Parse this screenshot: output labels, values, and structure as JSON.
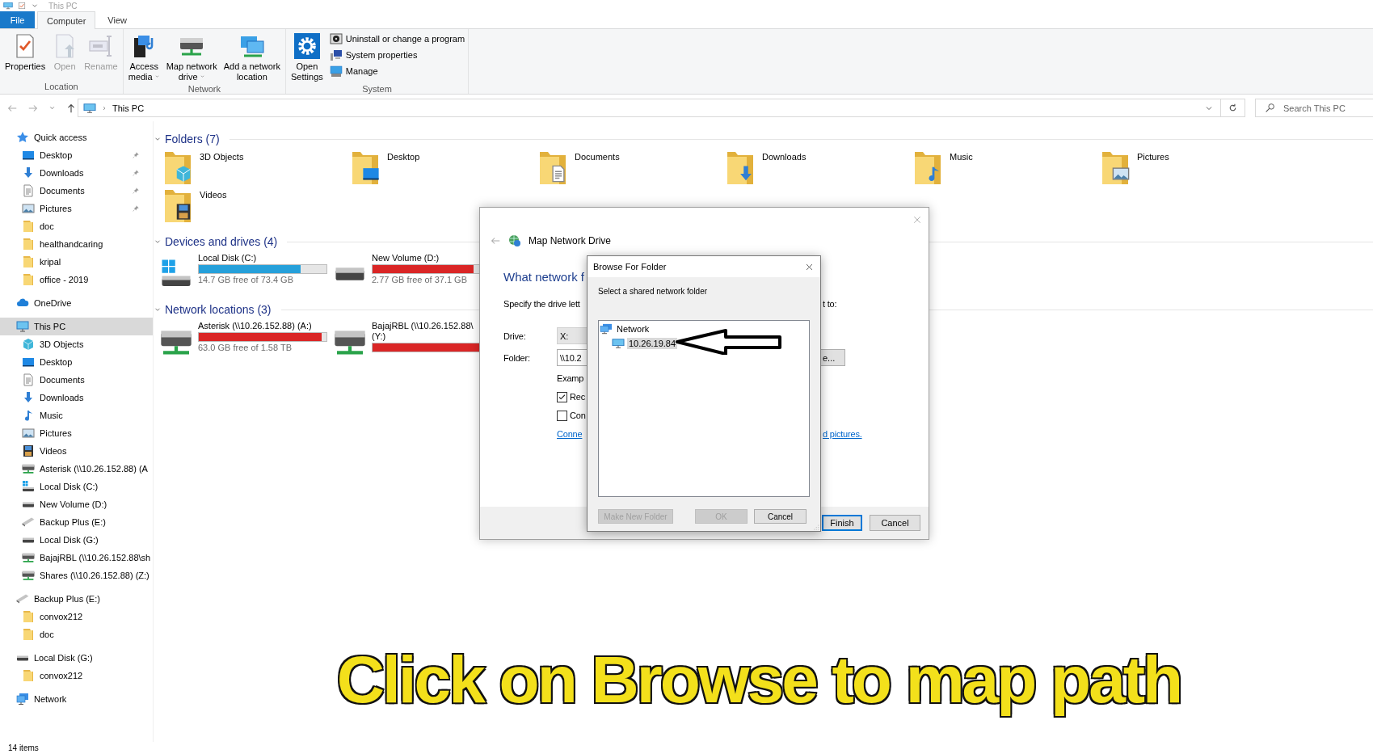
{
  "window": {
    "title": "This PC"
  },
  "ribbon": {
    "tabs": [
      {
        "label": "File",
        "kind": "file",
        "selected": false
      },
      {
        "label": "Computer",
        "kind": "tab",
        "selected": true
      },
      {
        "label": "View",
        "kind": "tab",
        "selected": false
      }
    ],
    "groups": [
      {
        "label": "Location",
        "buttons": [
          {
            "label": "Properties",
            "disabled": false,
            "dropdown": false
          },
          {
            "label": "Open",
            "disabled": true,
            "dropdown": false
          },
          {
            "label": "Rename",
            "disabled": true,
            "dropdown": false
          }
        ]
      },
      {
        "label": "Network",
        "buttons": [
          {
            "label": "Access\nmedia",
            "disabled": false,
            "dropdown": true
          },
          {
            "label": "Map network\ndrive",
            "disabled": false,
            "dropdown": true
          },
          {
            "label": "Add a network\nlocation",
            "disabled": false,
            "dropdown": false
          }
        ]
      },
      {
        "label": "System",
        "buttons": [
          {
            "label": "Open\nSettings",
            "disabled": false,
            "dropdown": false
          }
        ],
        "small_buttons": [
          {
            "label": "Uninstall or change a program"
          },
          {
            "label": "System properties"
          },
          {
            "label": "Manage"
          }
        ]
      }
    ]
  },
  "address_bar": {
    "path": "This PC",
    "search": {
      "placeholder": "Search This PC"
    }
  },
  "sidebar": {
    "items": [
      {
        "label": "Quick access",
        "kind": "star",
        "selected": false,
        "children": [
          {
            "label": "Desktop",
            "kind": "desktop",
            "pinned": true,
            "selected": false
          },
          {
            "label": "Downloads",
            "kind": "download",
            "pinned": true,
            "selected": false
          },
          {
            "label": "Documents",
            "kind": "document",
            "pinned": true,
            "selected": false
          },
          {
            "label": "Pictures",
            "kind": "pictures",
            "pinned": true,
            "selected": false
          },
          {
            "label": "doc",
            "kind": "folder",
            "pinned": false,
            "selected": false
          },
          {
            "label": "healthandcaring",
            "kind": "folder",
            "pinned": false,
            "selected": false
          },
          {
            "label": "kripal",
            "kind": "folder",
            "pinned": false,
            "selected": false
          },
          {
            "label": "office - 2019",
            "kind": "folder",
            "pinned": false,
            "selected": false
          }
        ]
      },
      {
        "label": "OneDrive",
        "kind": "cloud",
        "selected": false
      },
      {
        "label": "This PC",
        "kind": "pc",
        "selected": true,
        "children": [
          {
            "label": "3D Objects",
            "kind": "cube",
            "selected": false
          },
          {
            "label": "Desktop",
            "kind": "desktop",
            "selected": false
          },
          {
            "label": "Documents",
            "kind": "document",
            "selected": false
          },
          {
            "label": "Downloads",
            "kind": "download",
            "selected": false
          },
          {
            "label": "Music",
            "kind": "music",
            "selected": false
          },
          {
            "label": "Pictures",
            "kind": "pictures",
            "selected": false
          },
          {
            "label": "Videos",
            "kind": "video",
            "selected": false
          },
          {
            "label": "Asterisk (\\\\10.26.152.88) (A",
            "kind": "netdrive",
            "selected": false
          },
          {
            "label": "Local Disk (C:)",
            "kind": "windrive",
            "selected": false
          },
          {
            "label": "New Volume (D:)",
            "kind": "drive",
            "selected": false
          },
          {
            "label": "Backup Plus (E:)",
            "kind": "usb",
            "selected": false
          },
          {
            "label": "Local Disk (G:)",
            "kind": "drive",
            "selected": false
          },
          {
            "label": "BajajRBL (\\\\10.26.152.88\\sh",
            "kind": "netdrive",
            "selected": false
          },
          {
            "label": "Shares (\\\\10.26.152.88) (Z:)",
            "kind": "netdrive",
            "selected": false
          }
        ]
      },
      {
        "label": "Backup Plus (E:)",
        "kind": "usb",
        "selected": false,
        "children": [
          {
            "label": "convox212",
            "kind": "folder",
            "selected": false
          },
          {
            "label": "doc",
            "kind": "folder",
            "selected": false
          }
        ]
      },
      {
        "label": "Local Disk (G:)",
        "kind": "drive",
        "selected": false,
        "children": [
          {
            "label": "convox212",
            "kind": "folder",
            "selected": false
          }
        ]
      },
      {
        "label": "Network",
        "kind": "network",
        "selected": false
      }
    ]
  },
  "sections": [
    {
      "title": "Folders (7)",
      "kind": "folders",
      "items": [
        {
          "name": "3D Objects",
          "kind": "cube"
        },
        {
          "name": "Desktop",
          "kind": "desktop"
        },
        {
          "name": "Documents",
          "kind": "document"
        },
        {
          "name": "Downloads",
          "kind": "download"
        },
        {
          "name": "Music",
          "kind": "music"
        },
        {
          "name": "Pictures",
          "kind": "pictures"
        },
        {
          "name": "Videos",
          "kind": "video"
        }
      ]
    },
    {
      "title": "Devices and drives (4)",
      "kind": "drives",
      "items": [
        {
          "name": "Local Disk (C:)",
          "kind": "windrive",
          "level": 0.8,
          "free": "14.7 GB free of 73.4 GB"
        },
        {
          "name": "New Volume (D:)",
          "kind": "drive",
          "level": 0.93,
          "free": "2.77 GB free of 37.1 GB"
        }
      ]
    },
    {
      "title": "Network locations (3)",
      "kind": "drives",
      "items": [
        {
          "name": "Asterisk (\\\\10.26.152.88) (A:)",
          "kind": "netdrive",
          "level": 0.96,
          "free": "63.0 GB free of 1.58 TB"
        },
        {
          "name": "BajajRBL (\\\\10.26.152.88\\",
          "name_line_2": "(Y:)",
          "kind": "netdrive",
          "level": 1
        }
      ]
    }
  ],
  "map_drive_dialog": {
    "title": "Map Network Drive",
    "heading": "What network f",
    "instruction": "Specify the drive lett",
    "instruction_end": "t to:",
    "drive": {
      "label": "Drive:",
      "value": "X:"
    },
    "folder": {
      "label": "Folder:",
      "value": "\\\\10.2"
    },
    "browse_button": "e...",
    "example": "Examp",
    "options": [
      {
        "label": "Rec",
        "checked": true
      },
      {
        "label": "Con",
        "checked": false
      }
    ],
    "link": "Conne",
    "link_end": "d pictures.",
    "buttons": [
      {
        "label": "Finish",
        "kind": "primary"
      },
      {
        "label": "Cancel",
        "kind": "normal"
      }
    ]
  },
  "browse_dialog": {
    "title": "Browse For Folder",
    "prompt": "Select a shared network folder",
    "tree": [
      {
        "label": "Network",
        "kind": "network",
        "selected": false,
        "children": [
          {
            "label": "10.26.19.84",
            "kind": "pc",
            "selected": true
          }
        ]
      }
    ],
    "buttons": [
      {
        "label": "Make New Folder",
        "disabled": true
      },
      {
        "label": "OK",
        "disabled": true
      },
      {
        "label": "Cancel",
        "disabled": false
      }
    ]
  },
  "caption": "Click on Browse to map path",
  "status_bar": {
    "items": "14 items"
  }
}
